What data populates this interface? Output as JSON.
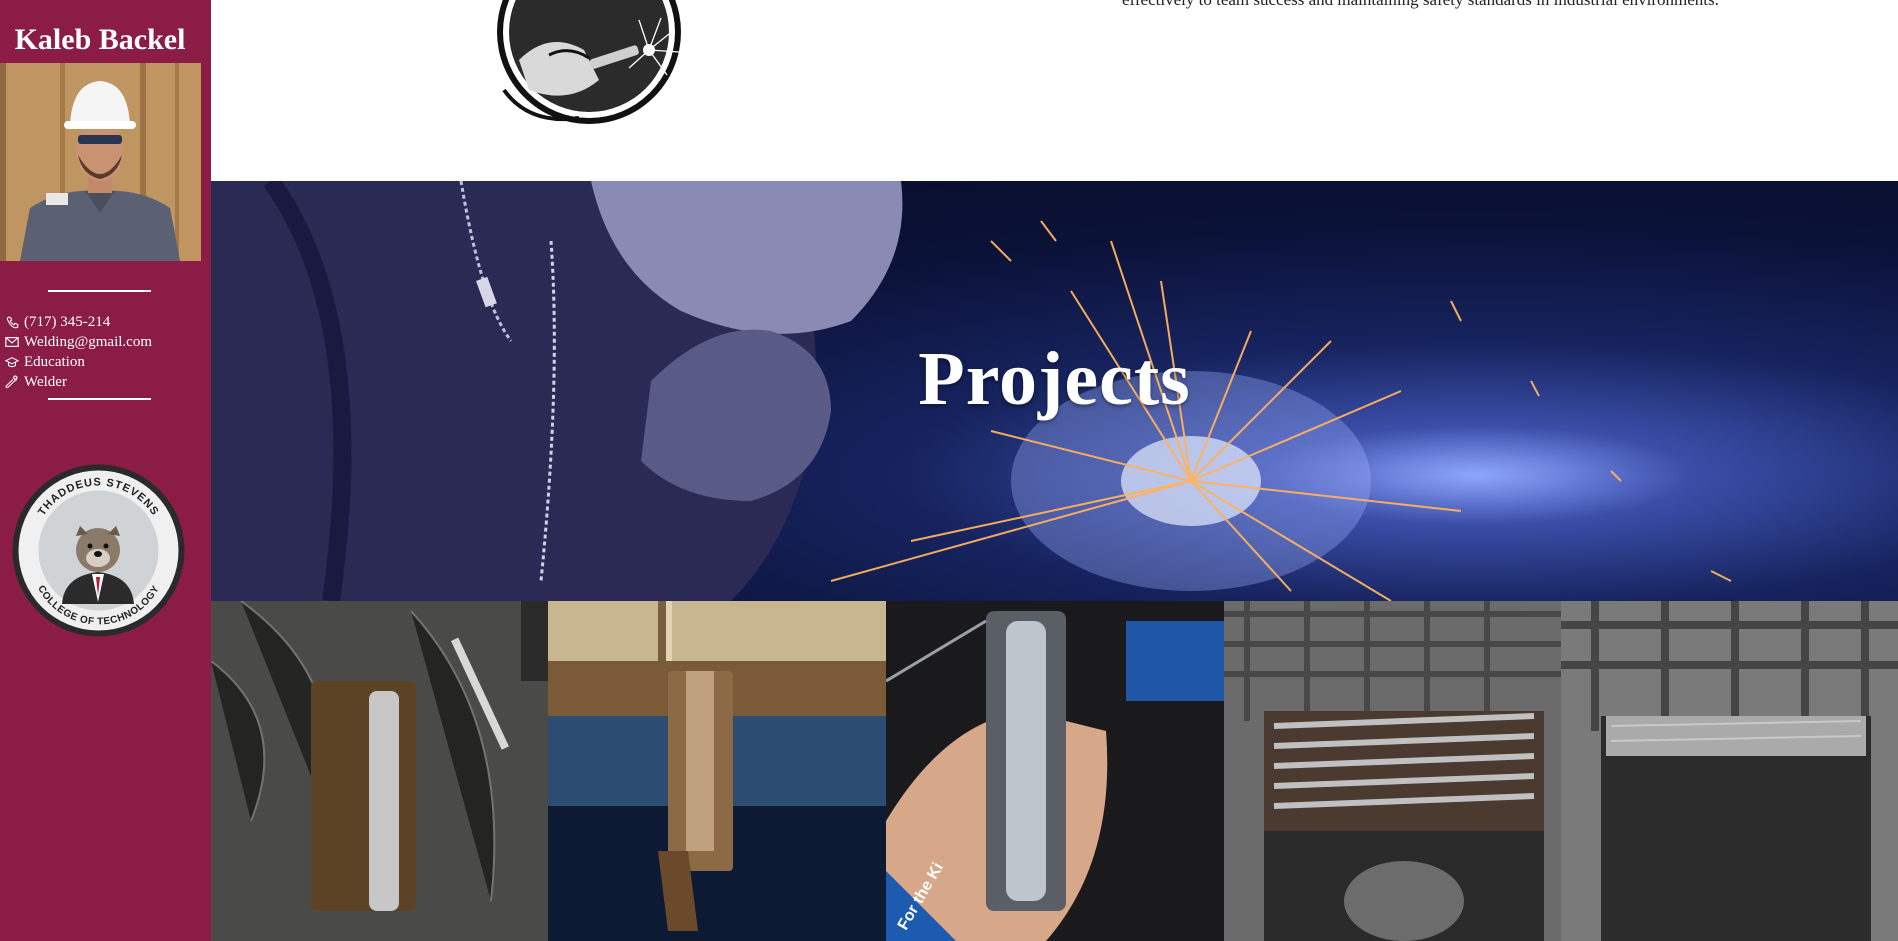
{
  "sidebar": {
    "name": "Kaleb Backel",
    "contacts": [
      {
        "icon": "phone-icon",
        "text": "(717) 345-214"
      },
      {
        "icon": "mail-icon",
        "text": "Welding@gmail.com"
      },
      {
        "icon": "graduation-cap-icon",
        "text": "Education"
      },
      {
        "icon": "wrench-icon",
        "text": "Welder"
      }
    ],
    "school_logo": {
      "top_text": "THADDEUS STEVENS",
      "bottom_text": "COLLEGE OF TECHNOLOGY"
    }
  },
  "main": {
    "intro_text": "effectively to team success and maintaining safety standards in industrial environments.",
    "hero_title": "Projects",
    "wristband_text": "For the Ki"
  },
  "colors": {
    "sidebar_bg": "#8b1c45",
    "text_light": "#ffffff",
    "hero_bg": "#0b1238"
  }
}
